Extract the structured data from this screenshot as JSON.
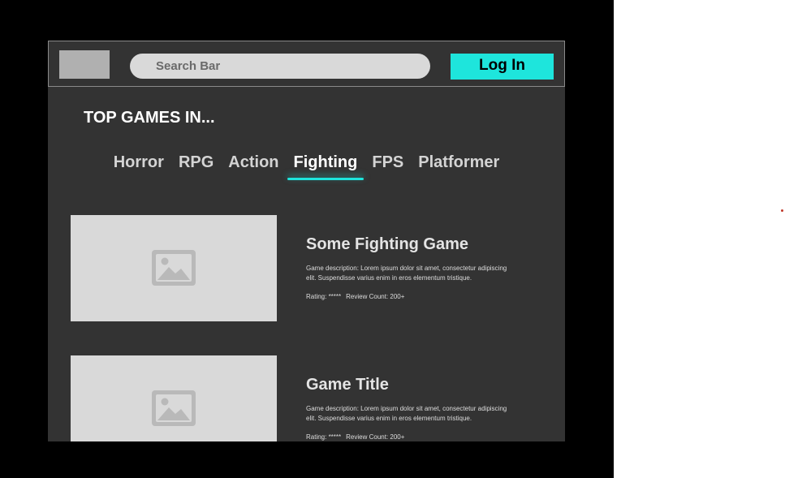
{
  "header": {
    "search_placeholder": "Search Bar",
    "login_label": "Log In"
  },
  "section": {
    "title": "TOP GAMES IN..."
  },
  "tabs": [
    {
      "label": "Horror",
      "active": false
    },
    {
      "label": "RPG",
      "active": false
    },
    {
      "label": "Action",
      "active": false
    },
    {
      "label": "Fighting",
      "active": true
    },
    {
      "label": "FPS",
      "active": false
    },
    {
      "label": "Platformer",
      "active": false
    }
  ],
  "games": [
    {
      "title": "Some Fighting Game",
      "description": "Game description: Lorem ipsum dolor sit amet, consectetur adipiscing elit. Suspendisse varius enim in eros elementum tristique.",
      "rating": "Rating: *****",
      "review_count": "Review Count: 200+",
      "image_icon": "image-placeholder-icon"
    },
    {
      "title": "Game Title",
      "description": "Game description: Lorem ipsum dolor sit amet, consectetur adipiscing elit. Suspendisse varius enim in eros elementum tristique.",
      "rating": "Rating: *****",
      "review_count": "Review Count: 200+",
      "image_icon": "image-placeholder-icon"
    }
  ],
  "colors": {
    "accent": "#1ee5dc",
    "frame_background": "#333333",
    "placeholder": "#d9d9d9"
  }
}
